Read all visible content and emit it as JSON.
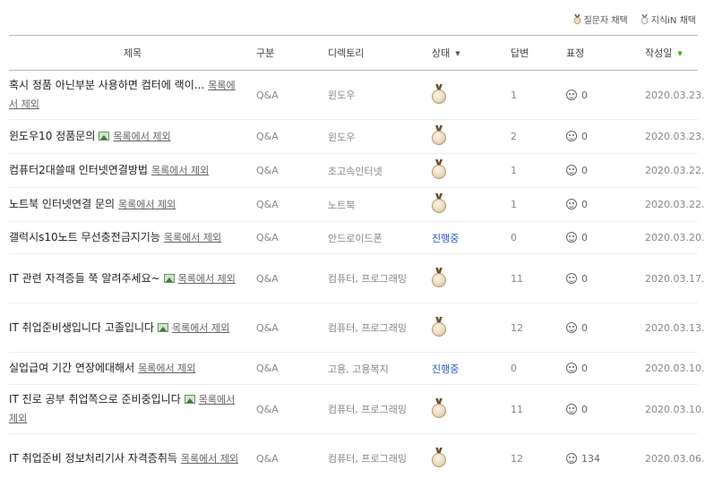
{
  "legend": {
    "asker_pick": "질문자 채택",
    "jisikin_pick": "지식iN 채택"
  },
  "columns": {
    "title": "제목",
    "category": "구분",
    "directory": "디렉토리",
    "status": "상태",
    "answers": "답변",
    "reactions": "표정",
    "date": "작성일"
  },
  "remove_label": "목록에서 제외",
  "rows": [
    {
      "title": "혹시 정품 아닌부분 사용하면 컴터에 랙이...",
      "has_image": false,
      "category": "Q&A",
      "directory": "윈도우",
      "status": "medal",
      "answers": "1",
      "reactions": "0",
      "date": "2020.03.23."
    },
    {
      "title": "윈도우10 정품문의",
      "has_image": true,
      "category": "Q&A",
      "directory": "윈도우",
      "status": "medal",
      "answers": "2",
      "reactions": "0",
      "date": "2020.03.23."
    },
    {
      "title": "컴퓨터2대쓸때 인터넷연결방법",
      "has_image": false,
      "category": "Q&A",
      "directory": "초고속인터넷",
      "status": "medal",
      "answers": "1",
      "reactions": "0",
      "date": "2020.03.22."
    },
    {
      "title": "노트북 인터넷연결 문의",
      "has_image": false,
      "category": "Q&A",
      "directory": "노트북",
      "status": "medal",
      "answers": "1",
      "reactions": "0",
      "date": "2020.03.22."
    },
    {
      "title": "갤럭시s10노트 무선충전금지기능",
      "has_image": false,
      "category": "Q&A",
      "directory": "안드로이드폰",
      "status": "진행중",
      "answers": "0",
      "reactions": "0",
      "date": "2020.03.20."
    },
    {
      "title": "IT 관련 자격증들 쭉 알려주세요~",
      "has_image": true,
      "category": "Q&A",
      "directory": "컴퓨터, 프로그래밍",
      "status": "medal",
      "answers": "11",
      "reactions": "0",
      "date": "2020.03.17."
    },
    {
      "title": "IT 취업준비생입니다 고졸입니다",
      "has_image": true,
      "category": "Q&A",
      "directory": "컴퓨터, 프로그래밍",
      "status": "medal",
      "answers": "12",
      "reactions": "0",
      "date": "2020.03.13."
    },
    {
      "title": "실업급여 기간 연장에대해서",
      "has_image": false,
      "category": "Q&A",
      "directory": "고용, 고용복지",
      "status": "진행중",
      "answers": "0",
      "reactions": "0",
      "date": "2020.03.10."
    },
    {
      "title": "IT 진로 공부 취업쪽으로 준비중입니다",
      "has_image": true,
      "category": "Q&A",
      "directory": "컴퓨터, 프로그래밍",
      "status": "medal",
      "answers": "11",
      "reactions": "0",
      "date": "2020.03.10."
    },
    {
      "title": "IT 취업준비 정보처리기사 자격증취득",
      "has_image": false,
      "category": "Q&A",
      "directory": "컴퓨터, 프로그래밍",
      "status": "medal",
      "answers": "12",
      "reactions": "134",
      "date": "2020.03.06."
    }
  ],
  "colors": {
    "status_progress": "#2a58c7",
    "sort_active": "#2db400"
  }
}
